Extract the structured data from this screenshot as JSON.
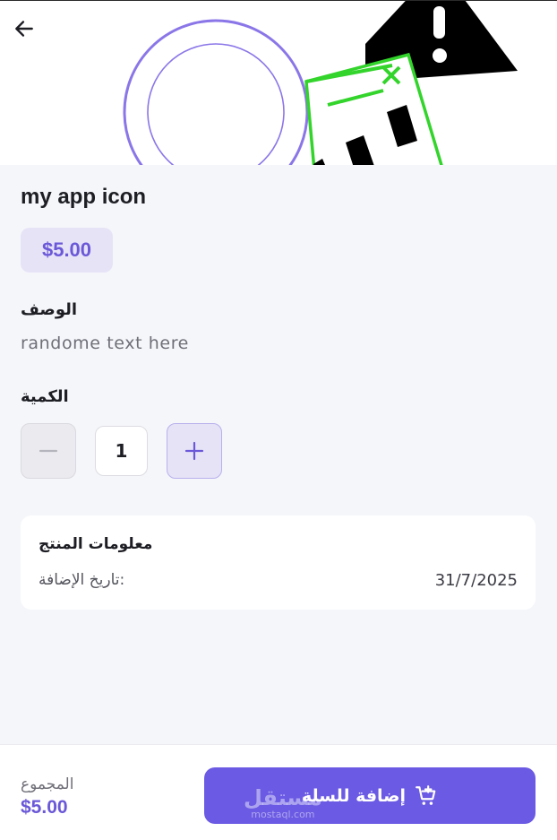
{
  "product": {
    "title": "my app icon",
    "price": "$5.00"
  },
  "description": {
    "label": "الوصف",
    "text": "randome text here"
  },
  "quantity": {
    "label": "الكمية",
    "value": "1"
  },
  "product_info": {
    "title": "معلومات المنتج",
    "date_key": "تاريخ الإضافة:",
    "date_value": "31/7/2025"
  },
  "footer": {
    "total_label": "المجموع",
    "total_value": "$5.00",
    "add_to_cart_label": "إضافة للسلة"
  },
  "watermark": {
    "main": "مستقل",
    "sub": "mostaql.com"
  },
  "icons": {
    "back": "arrow-left-icon",
    "minus": "minus-icon",
    "plus": "plus-icon",
    "cart": "cart-add-icon"
  },
  "colors": {
    "accent": "#6b5ae3",
    "accent_light": "#e6e3f7",
    "background": "#f5f6fa"
  }
}
